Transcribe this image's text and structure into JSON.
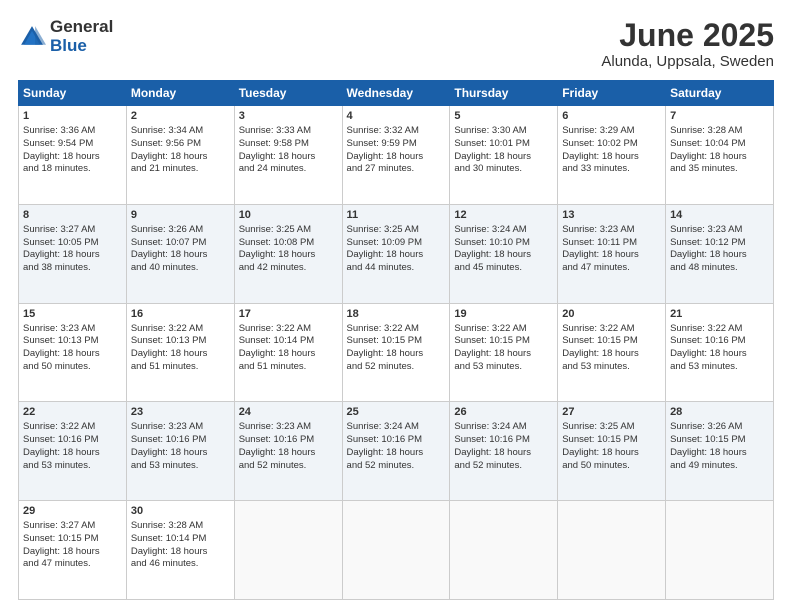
{
  "logo": {
    "general": "General",
    "blue": "Blue"
  },
  "title": "June 2025",
  "subtitle": "Alunda, Uppsala, Sweden",
  "days_of_week": [
    "Sunday",
    "Monday",
    "Tuesday",
    "Wednesday",
    "Thursday",
    "Friday",
    "Saturday"
  ],
  "weeks": [
    [
      {
        "day": 1,
        "info": "Sunrise: 3:36 AM\nSunset: 9:54 PM\nDaylight: 18 hours\nand 18 minutes."
      },
      {
        "day": 2,
        "info": "Sunrise: 3:34 AM\nSunset: 9:56 PM\nDaylight: 18 hours\nand 21 minutes."
      },
      {
        "day": 3,
        "info": "Sunrise: 3:33 AM\nSunset: 9:58 PM\nDaylight: 18 hours\nand 24 minutes."
      },
      {
        "day": 4,
        "info": "Sunrise: 3:32 AM\nSunset: 9:59 PM\nDaylight: 18 hours\nand 27 minutes."
      },
      {
        "day": 5,
        "info": "Sunrise: 3:30 AM\nSunset: 10:01 PM\nDaylight: 18 hours\nand 30 minutes."
      },
      {
        "day": 6,
        "info": "Sunrise: 3:29 AM\nSunset: 10:02 PM\nDaylight: 18 hours\nand 33 minutes."
      },
      {
        "day": 7,
        "info": "Sunrise: 3:28 AM\nSunset: 10:04 PM\nDaylight: 18 hours\nand 35 minutes."
      }
    ],
    [
      {
        "day": 8,
        "info": "Sunrise: 3:27 AM\nSunset: 10:05 PM\nDaylight: 18 hours\nand 38 minutes."
      },
      {
        "day": 9,
        "info": "Sunrise: 3:26 AM\nSunset: 10:07 PM\nDaylight: 18 hours\nand 40 minutes."
      },
      {
        "day": 10,
        "info": "Sunrise: 3:25 AM\nSunset: 10:08 PM\nDaylight: 18 hours\nand 42 minutes."
      },
      {
        "day": 11,
        "info": "Sunrise: 3:25 AM\nSunset: 10:09 PM\nDaylight: 18 hours\nand 44 minutes."
      },
      {
        "day": 12,
        "info": "Sunrise: 3:24 AM\nSunset: 10:10 PM\nDaylight: 18 hours\nand 45 minutes."
      },
      {
        "day": 13,
        "info": "Sunrise: 3:23 AM\nSunset: 10:11 PM\nDaylight: 18 hours\nand 47 minutes."
      },
      {
        "day": 14,
        "info": "Sunrise: 3:23 AM\nSunset: 10:12 PM\nDaylight: 18 hours\nand 48 minutes."
      }
    ],
    [
      {
        "day": 15,
        "info": "Sunrise: 3:23 AM\nSunset: 10:13 PM\nDaylight: 18 hours\nand 50 minutes."
      },
      {
        "day": 16,
        "info": "Sunrise: 3:22 AM\nSunset: 10:13 PM\nDaylight: 18 hours\nand 51 minutes."
      },
      {
        "day": 17,
        "info": "Sunrise: 3:22 AM\nSunset: 10:14 PM\nDaylight: 18 hours\nand 51 minutes."
      },
      {
        "day": 18,
        "info": "Sunrise: 3:22 AM\nSunset: 10:15 PM\nDaylight: 18 hours\nand 52 minutes."
      },
      {
        "day": 19,
        "info": "Sunrise: 3:22 AM\nSunset: 10:15 PM\nDaylight: 18 hours\nand 53 minutes."
      },
      {
        "day": 20,
        "info": "Sunrise: 3:22 AM\nSunset: 10:15 PM\nDaylight: 18 hours\nand 53 minutes."
      },
      {
        "day": 21,
        "info": "Sunrise: 3:22 AM\nSunset: 10:16 PM\nDaylight: 18 hours\nand 53 minutes."
      }
    ],
    [
      {
        "day": 22,
        "info": "Sunrise: 3:22 AM\nSunset: 10:16 PM\nDaylight: 18 hours\nand 53 minutes."
      },
      {
        "day": 23,
        "info": "Sunrise: 3:23 AM\nSunset: 10:16 PM\nDaylight: 18 hours\nand 53 minutes."
      },
      {
        "day": 24,
        "info": "Sunrise: 3:23 AM\nSunset: 10:16 PM\nDaylight: 18 hours\nand 52 minutes."
      },
      {
        "day": 25,
        "info": "Sunrise: 3:24 AM\nSunset: 10:16 PM\nDaylight: 18 hours\nand 52 minutes."
      },
      {
        "day": 26,
        "info": "Sunrise: 3:24 AM\nSunset: 10:16 PM\nDaylight: 18 hours\nand 52 minutes."
      },
      {
        "day": 27,
        "info": "Sunrise: 3:25 AM\nSunset: 10:15 PM\nDaylight: 18 hours\nand 50 minutes."
      },
      {
        "day": 28,
        "info": "Sunrise: 3:26 AM\nSunset: 10:15 PM\nDaylight: 18 hours\nand 49 minutes."
      }
    ],
    [
      {
        "day": 29,
        "info": "Sunrise: 3:27 AM\nSunset: 10:15 PM\nDaylight: 18 hours\nand 47 minutes."
      },
      {
        "day": 30,
        "info": "Sunrise: 3:28 AM\nSunset: 10:14 PM\nDaylight: 18 hours\nand 46 minutes."
      },
      null,
      null,
      null,
      null,
      null
    ]
  ]
}
